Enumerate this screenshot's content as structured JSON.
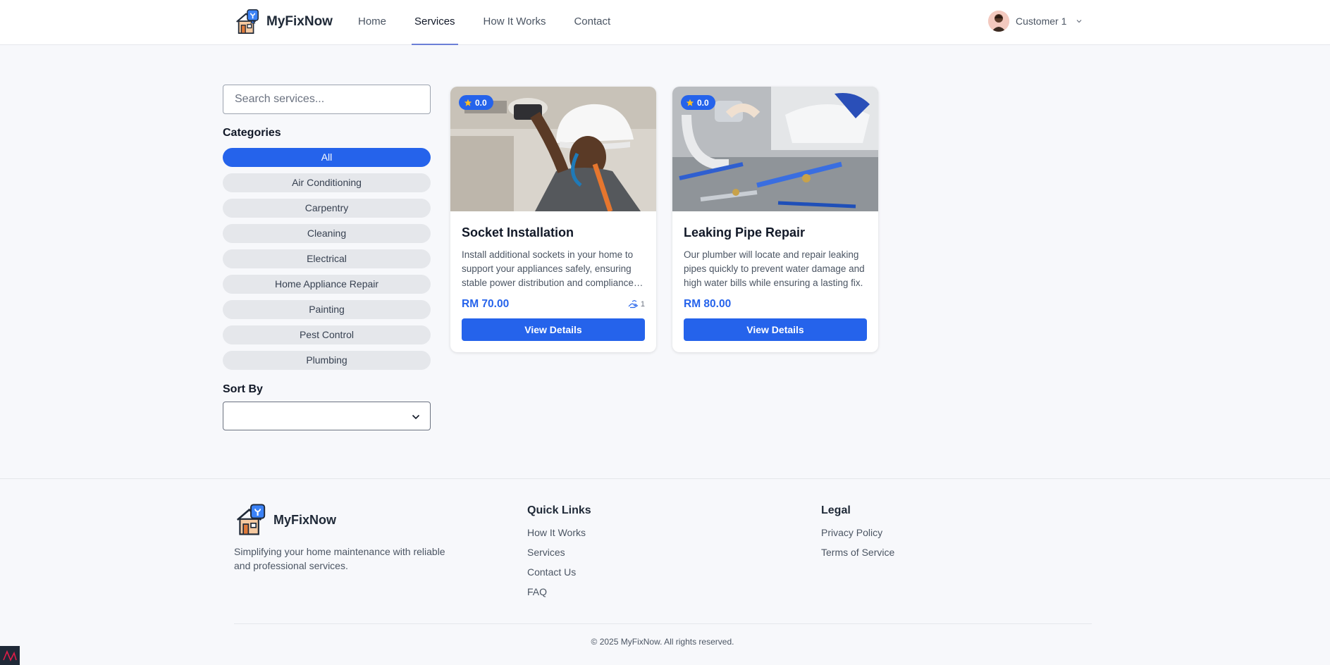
{
  "header": {
    "brand": "MyFixNow",
    "nav": [
      {
        "label": "Home",
        "active": false
      },
      {
        "label": "Services",
        "active": true
      },
      {
        "label": "How It Works",
        "active": false
      },
      {
        "label": "Contact",
        "active": false
      }
    ],
    "user": {
      "name": "Customer 1"
    }
  },
  "sidebar": {
    "search_placeholder": "Search services...",
    "categories_title": "Categories",
    "categories": [
      {
        "label": "All",
        "active": true
      },
      {
        "label": "Air Conditioning",
        "active": false
      },
      {
        "label": "Carpentry",
        "active": false
      },
      {
        "label": "Cleaning",
        "active": false
      },
      {
        "label": "Electrical",
        "active": false
      },
      {
        "label": "Home Appliance Repair",
        "active": false
      },
      {
        "label": "Painting",
        "active": false
      },
      {
        "label": "Pest Control",
        "active": false
      },
      {
        "label": "Plumbing",
        "active": false
      }
    ],
    "sort_title": "Sort By",
    "sort_value": ""
  },
  "services": [
    {
      "rating": "0.0",
      "title": "Socket Installation",
      "description": "Install additional sockets in your home to support your appliances safely, ensuring stable power distribution and compliance with safety standards.",
      "price": "RM 70.00",
      "bookings": "1",
      "button": "View Details"
    },
    {
      "rating": "0.0",
      "title": "Leaking Pipe Repair",
      "description": "Our plumber will locate and repair leaking pipes quickly to prevent water damage and high water bills while ensuring a lasting fix.",
      "price": "RM 80.00",
      "bookings": "",
      "button": "View Details"
    }
  ],
  "footer": {
    "brand": "MyFixNow",
    "tagline": "Simplifying your home maintenance with reliable and professional services.",
    "quick_links_title": "Quick Links",
    "quick_links": [
      "How It Works",
      "Services",
      "Contact Us",
      "FAQ"
    ],
    "legal_title": "Legal",
    "legal_links": [
      "Privacy Policy",
      "Terms of Service"
    ],
    "copyright": "© 2025 MyFixNow. All rights reserved."
  },
  "colors": {
    "primary": "#2563eb",
    "pill": "#e5e7eb",
    "background": "#f7f8fb",
    "nav_underline": "#6b7fd7",
    "rating_star": "#fbbf24"
  },
  "icons": {
    "logo": "house-tools-logo-icon",
    "user_menu": "chevron-down-icon",
    "sort": "chevron-down-icon",
    "rating": "star-icon",
    "bookings": "hand-booking-icon"
  }
}
